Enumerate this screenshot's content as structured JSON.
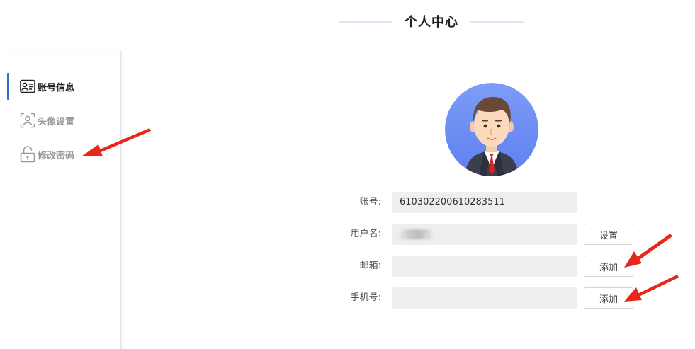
{
  "header": {
    "title": "个人中心"
  },
  "sidebar": {
    "items": [
      {
        "label": "账号信息",
        "icon": "id-card-icon",
        "active": true
      },
      {
        "label": "头像设置",
        "icon": "face-scan-icon",
        "active": false
      },
      {
        "label": "修改密码",
        "icon": "unlock-icon",
        "active": false
      }
    ]
  },
  "form": {
    "account": {
      "label": "账号:",
      "value": "610302200610283511"
    },
    "username": {
      "label": "用户名:",
      "value": "",
      "button": "设置"
    },
    "email": {
      "label": "邮箱:",
      "value": "",
      "button": "添加"
    },
    "phone": {
      "label": "手机号:",
      "value": "",
      "button": "添加"
    }
  },
  "colors": {
    "accent": "#3569d3",
    "annotation_arrow": "#e8261b",
    "avatar_bg": "#6f8ff5"
  }
}
